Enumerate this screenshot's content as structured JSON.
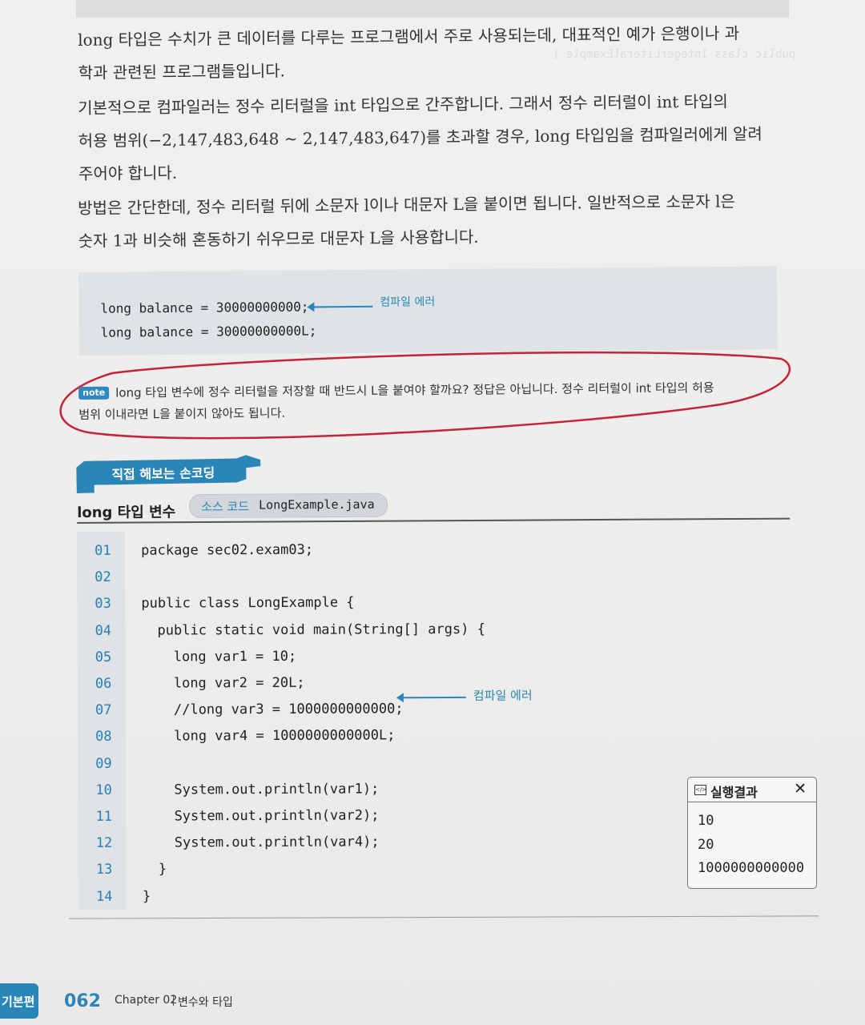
{
  "paragraphs": {
    "p1_line1": "long 타입은 수치가 큰 데이터를 다루는 프로그램에서 주로 사용되는데, 대표적인 예가 은행이나 과",
    "p1_line2": "학과 관련된 프로그램들입니다.",
    "p2_line1": "기본적으로 컴파일러는 정수 리터럴을 int 타입으로 간주합니다. 그래서 정수 리터럴이 int 타입의",
    "p2_line2": "허용 범위(−2,147,483,648 ~ 2,147,483,647)를 초과할 경우, long 타입임을 컴파일러에게 알려",
    "p2_line3": "주어야 합니다.",
    "p3_line1": "방법은 간단한데, 정수 리터럴 뒤에 소문자 l이나 대문자 L을 붙이면 됩니다. 일반적으로 소문자 l은",
    "p3_line2": "숫자 1과 비슷해 혼동하기 쉬우므로 대문자 L을 사용합니다."
  },
  "snippet": {
    "line1": "long balance = 30000000000;",
    "line2": "long balance = 30000000000L;",
    "annotation": "컴파일 에러"
  },
  "note": {
    "badge": "note",
    "line1": "long 타입 변수에 정수 리터럴을 저장할 때 반드시 L을 붙여야 할까요? 정답은 아닙니다. 정수 리터럴이 int 타입의 허용",
    "line2": "범위 이내라면 L을 붙이지 않아도 됩니다."
  },
  "section": {
    "banner": "직접 해보는 손코딩",
    "title": "long 타입 변수",
    "source_label": "소스 코드",
    "source_file": "LongExample.java"
  },
  "listing": [
    {
      "num": "01",
      "code": "package sec02.exam03;",
      "indent": 0
    },
    {
      "num": "02",
      "code": "",
      "indent": 0
    },
    {
      "num": "03",
      "code": "public class LongExample {",
      "indent": 0
    },
    {
      "num": "04",
      "code": "public static void main(String[] args) {",
      "indent": 1
    },
    {
      "num": "05",
      "code": "long var1 = 10;",
      "indent": 2
    },
    {
      "num": "06",
      "code": "long var2 = 20L;",
      "indent": 2
    },
    {
      "num": "07",
      "code": "//long var3 = 1000000000000;",
      "indent": 2
    },
    {
      "num": "08",
      "code": "long var4 = 1000000000000L;",
      "indent": 2
    },
    {
      "num": "09",
      "code": "",
      "indent": 0
    },
    {
      "num": "10",
      "code": "System.out.println(var1);",
      "indent": 2
    },
    {
      "num": "11",
      "code": "System.out.println(var2);",
      "indent": 2
    },
    {
      "num": "12",
      "code": "System.out.println(var4);",
      "indent": 2
    },
    {
      "num": "13",
      "code": "}",
      "indent": 1
    },
    {
      "num": "14",
      "code": "}",
      "indent": 0
    }
  ],
  "listing_annotation": "컴파일 에러",
  "result": {
    "title": "실행결과",
    "close": "✕",
    "lines": [
      "10",
      "20",
      "1000000000000"
    ]
  },
  "footer": {
    "tab": "기본편",
    "page": "062",
    "chapter": "Chapter 02",
    "title": "변수와 타입"
  },
  "colors": {
    "accent": "#2a86b8",
    "code_bg": "#dfe3e6",
    "red_mark": "#c4243a"
  }
}
